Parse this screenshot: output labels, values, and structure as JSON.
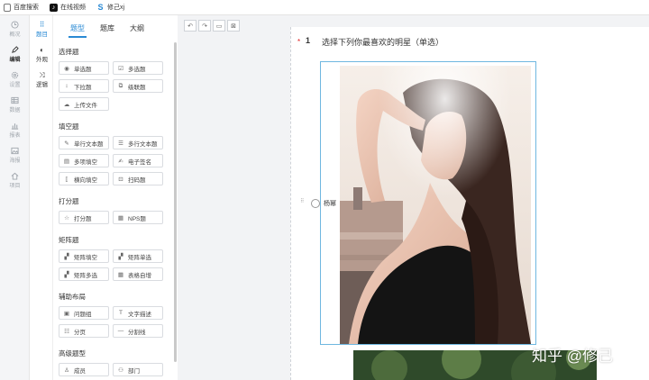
{
  "bookmarks": [
    {
      "label": "百度搜索",
      "icon": "document-icon"
    },
    {
      "label": "在线视频",
      "icon": "tiktok-icon"
    },
    {
      "label": "修己xj",
      "icon": "s-logo-icon"
    }
  ],
  "rail": [
    {
      "label": "概况",
      "icon": "clock-icon",
      "active": false
    },
    {
      "label": "编辑",
      "icon": "pencil-icon",
      "active": true
    },
    {
      "label": "设置",
      "icon": "gear-icon",
      "active": false
    },
    {
      "label": "数据",
      "icon": "table-icon",
      "active": false
    },
    {
      "label": "报表",
      "icon": "bar-chart-icon",
      "active": false
    },
    {
      "label": "海报",
      "icon": "image-icon",
      "active": false
    },
    {
      "label": "项目",
      "icon": "home-icon",
      "active": false
    }
  ],
  "rail2": [
    {
      "label": "题目",
      "glyph": "⠿",
      "active": true
    },
    {
      "label": "外观",
      "glyph": "◐",
      "active": false
    },
    {
      "label": "逻辑",
      "glyph": "⤨",
      "active": false
    }
  ],
  "tabs": [
    {
      "label": "题型",
      "active": true
    },
    {
      "label": "题库",
      "active": false
    },
    {
      "label": "大纲",
      "active": false
    }
  ],
  "sections": [
    {
      "title": "选择题",
      "items": [
        {
          "label": "单选题",
          "glyph": "◉"
        },
        {
          "label": "多选题",
          "glyph": "☑"
        },
        {
          "label": "下拉题",
          "glyph": "↕"
        },
        {
          "label": "级联题",
          "glyph": "⧉"
        },
        {
          "label": "上传文件",
          "glyph": "☁"
        }
      ]
    },
    {
      "title": "填空题",
      "items": [
        {
          "label": "单行文本题",
          "glyph": "✎"
        },
        {
          "label": "多行文本题",
          "glyph": "☰"
        },
        {
          "label": "多项填空",
          "glyph": "▤"
        },
        {
          "label": "电子签名",
          "glyph": "✍"
        },
        {
          "label": "横向填空",
          "glyph": "⟦"
        },
        {
          "label": "扫码题",
          "glyph": "⊡"
        }
      ]
    },
    {
      "title": "打分题",
      "items": [
        {
          "label": "打分题",
          "glyph": "☆"
        },
        {
          "label": "NPS题",
          "glyph": "▦"
        }
      ]
    },
    {
      "title": "矩阵题",
      "items": [
        {
          "label": "矩阵填空",
          "glyph": "▞"
        },
        {
          "label": "矩阵单选",
          "glyph": "▞"
        },
        {
          "label": "矩阵多选",
          "glyph": "▞"
        },
        {
          "label": "表格自增",
          "glyph": "▦"
        }
      ]
    },
    {
      "title": "辅助布局",
      "items": [
        {
          "label": "问题组",
          "glyph": "▣"
        },
        {
          "label": "文字描述",
          "glyph": "T"
        },
        {
          "label": "分页",
          "glyph": "☷"
        },
        {
          "label": "分割线",
          "glyph": "—"
        }
      ]
    },
    {
      "title": "高级题型",
      "items": [
        {
          "label": "成员",
          "glyph": "♙"
        },
        {
          "label": "部门",
          "glyph": "⚇"
        }
      ]
    }
  ],
  "toolbar": [
    "↶",
    "↷",
    "▭",
    "⊠"
  ],
  "question": {
    "required_mark": "*",
    "number": "1",
    "text": "选择下列你最喜欢的明星（单选）",
    "option_label": "杨幂"
  },
  "watermark": "知乎 @修己",
  "colors": {
    "accent": "#2a8ad4",
    "required": "#e02020"
  }
}
